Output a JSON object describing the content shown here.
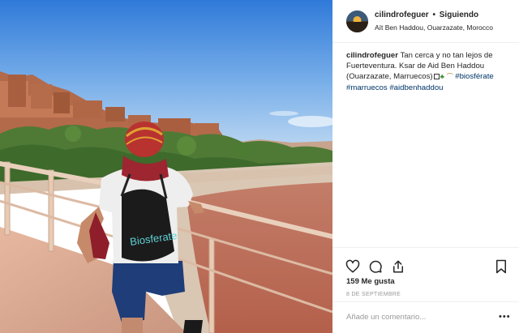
{
  "header": {
    "username": "cilindrofeguer",
    "separator": "•",
    "follow_label": "Siguiendo",
    "location": "Aït Ben Haddou, Ouarzazate, Morocco"
  },
  "caption": {
    "username": "cilindrofeguer",
    "text": "Tan cerca y no tan lejos de Fuerteventura. Ksar de Aid Ben Haddou (Ouarzazate, Marruecos)",
    "hashtags": [
      "#biosférate",
      "#marruecos",
      "#aidbenhaddou"
    ]
  },
  "photo": {
    "bag_text": "Biosferate"
  },
  "actions": {
    "icons": [
      "heart-icon",
      "comment-icon",
      "share-icon",
      "bookmark-icon"
    ]
  },
  "likes": "159 Me gusta",
  "date": "8 DE SEPTIEMBRE",
  "comment": {
    "placeholder": "Añade un comentario...",
    "more": "•••"
  },
  "colors": {
    "link": "#003569",
    "border": "#efefef",
    "muted": "#999999"
  }
}
